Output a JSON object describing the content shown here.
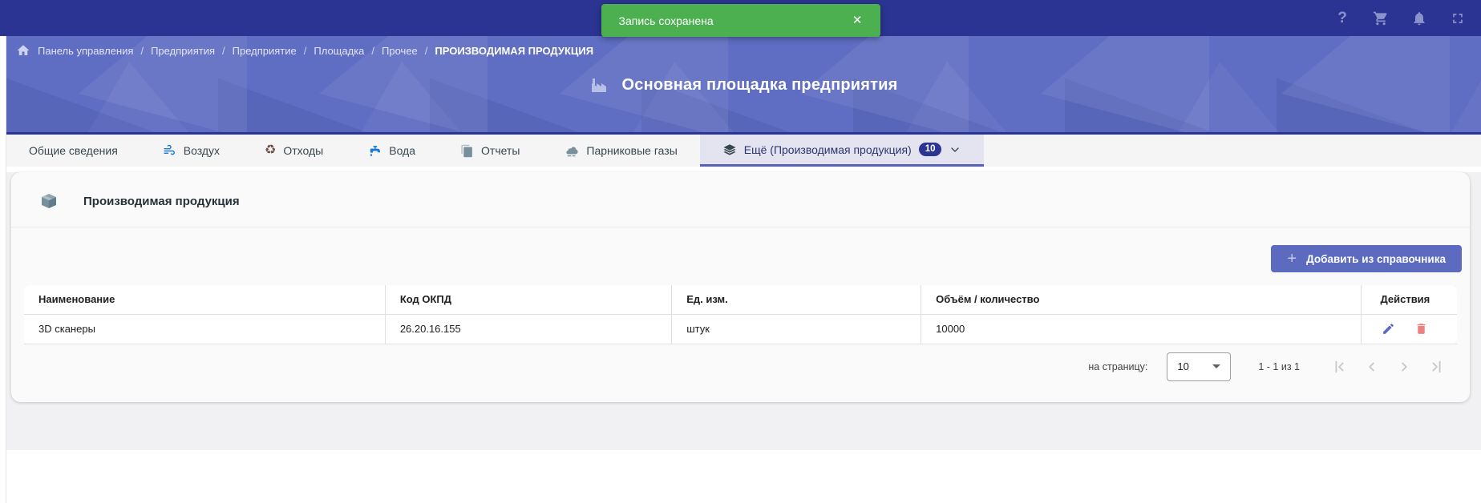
{
  "toast": {
    "message": "Запись сохранена",
    "close": "✕"
  },
  "topbar": {
    "help": "?"
  },
  "breadcrumb": {
    "separator": "/",
    "items": [
      "Панель управления",
      "Предприятия",
      "Предприятие",
      "Площадка",
      "Прочее",
      "ПРОИЗВОДИМАЯ ПРОДУКЦИЯ"
    ]
  },
  "banner": {
    "title": "Основная площадка предприятия"
  },
  "tabs": {
    "items": [
      {
        "label": "Общие сведения"
      },
      {
        "label": "Воздух"
      },
      {
        "label": "Отходы"
      },
      {
        "label": "Вода"
      },
      {
        "label": "Отчеты"
      },
      {
        "label": "Парниковые газы"
      },
      {
        "label": "Ещё (Производимая продукция)",
        "badge": "10",
        "active": true
      }
    ],
    "recycle_glyph": "♻"
  },
  "section": {
    "title": "Производимая продукция",
    "add_button_label": "Добавить из справочника",
    "add_plus": "+"
  },
  "table": {
    "columns": [
      "Наименование",
      "Код ОКПД",
      "Ед. изм.",
      "Объём / количество",
      "Действия"
    ],
    "rows": [
      {
        "name": "3D сканеры",
        "okpd": "26.20.16.155",
        "unit": "штук",
        "volume": "10000"
      }
    ]
  },
  "paginator": {
    "per_page_label": "на страницу:",
    "per_page": "10",
    "range": "1 - 1 из 1"
  },
  "colors": {
    "topbar": "#2b3492",
    "banner": "#5f6dc2",
    "accent": "#5c6bc0",
    "toast_bg": "#4caf50",
    "delete_icon": "#ef8080",
    "badge_bg": "#2b3492"
  }
}
